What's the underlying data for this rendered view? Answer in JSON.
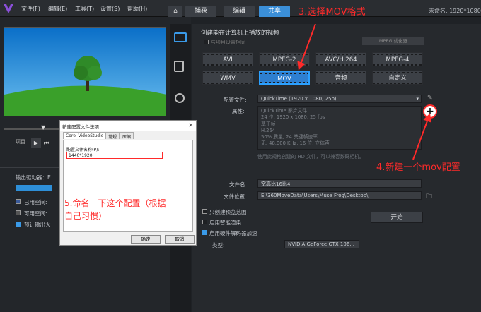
{
  "menu": {
    "file": "文件(F)",
    "edit": "编辑(E)",
    "tools": "工具(T)",
    "settings": "设置(S)",
    "help": "帮助(H)"
  },
  "tabs": {
    "capture": "捕获",
    "edit": "编辑",
    "share": "共享"
  },
  "project_info": "未命名, 1920*1080",
  "annotations": {
    "step3": "3.选择MOV格式",
    "step4": "4.新建一个mov配置",
    "step5": "5.命名一下这个配置（根据自己习惯）"
  },
  "left": {
    "project_label": "项目",
    "output_drive": "输出驱动器：E",
    "used": "已用空间:",
    "free": "可用空间:",
    "estimated": "预计输出大"
  },
  "share": {
    "header": "创建能在计算机上播放的视频",
    "same_as_project": "与项目设置相同",
    "mpeg_optimizer": "MPEG 优化器",
    "formats": [
      "AVI",
      "MPEG-2",
      "AVC/H.264",
      "MPEG-4",
      "WMV",
      "MOV",
      "音频",
      "自定义"
    ],
    "selected_format": "MOV",
    "profile_label": "配置文件:",
    "profile_value": "QuickTime (1920 x 1080, 25p)",
    "attributes_label": "属性:",
    "attributes": [
      "QuickTime 影片文件",
      "24 位, 1920 x 1080, 25 fps",
      "基于帧",
      "H.264",
      "50% 质量, 24 关键帧速率",
      "无, 48,000 KHz, 16 位, 立体声"
    ],
    "hint": "使用此规格创建的 HD 文件，可以兼容数码相机。",
    "filename_label": "文件名:",
    "filename_value": "宽高比16比4",
    "location_label": "文件位置:",
    "location_value": "E:\\360MoveData\\Users\\Muse Frog\\Desktop\\",
    "opt1": "只创建预览范围",
    "opt2": "启用智能渲染",
    "opt3": "启用硬件解码器加速",
    "type_label": "类型:",
    "type_value": "NVIDIA GeForce GTX 106...",
    "start": "开始"
  },
  "dialog": {
    "title": "新建配置文件选项",
    "tabs": [
      "Corel VideoStudio",
      "常规",
      "压缩"
    ],
    "name_label": "配置文件名称(P):",
    "name_value": "1440*1920",
    "ok": "确定",
    "cancel": "取消"
  },
  "colors": {
    "accent": "#3b8fd8",
    "annotation": "#ff2a2a"
  }
}
